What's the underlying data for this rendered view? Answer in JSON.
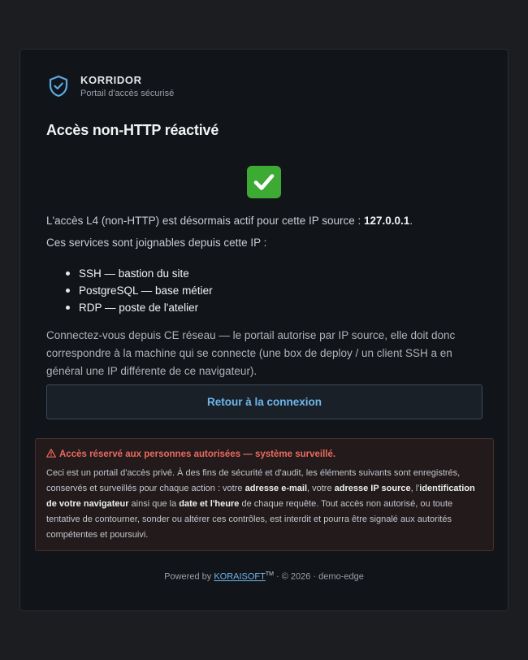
{
  "brand": {
    "name": "KORRIDOR",
    "subtitle": "Portail d'accès sécurisé",
    "icon": "shield-check-icon",
    "accent": "#5aa9e6"
  },
  "page": {
    "title": "Accès non-HTTP réactivé",
    "status_icon": "check-mark-button-icon",
    "intro_prefix": "L'accès L4 (non-HTTP) est désormais actif pour cette IP source : ",
    "source_ip": "127.0.0.1",
    "intro_suffix": ".",
    "services_intro": "Ces services sont joignables depuis cette IP :",
    "services": [
      "SSH — bastion du site",
      "PostgreSQL — base métier",
      "RDP — poste de l'atelier"
    ],
    "note": "Connectez-vous depuis CE réseau — le portail autorise par IP source, elle doit donc correspondre à la machine qui se connecte (une box de deploy / un client SSH a en général une IP différente de ce navigateur).",
    "back_button": "Retour à la connexion"
  },
  "warning": {
    "icon": "warning-triangle-icon",
    "title": "Accès réservé aux personnes autorisées — système surveillé.",
    "body": [
      {
        "t": "Ceci est un portail d'accès privé. À des fins de sécurité et d'audit, les éléments suivants sont enregistrés, conservés et surveillés pour chaque action : votre ",
        "b": false
      },
      {
        "t": "adresse e-mail",
        "b": true
      },
      {
        "t": ", votre ",
        "b": false
      },
      {
        "t": "adresse IP source",
        "b": true
      },
      {
        "t": ", l'",
        "b": false
      },
      {
        "t": "identification de votre navigateur",
        "b": true
      },
      {
        "t": " ainsi que la ",
        "b": false
      },
      {
        "t": "date et l'heure",
        "b": true
      },
      {
        "t": " de chaque requête. Tout accès non autorisé, ou toute tentative de contourner, sonder ou altérer ces contrôles, est interdit et pourra être signalé aux autorités compétentes et poursuivi.",
        "b": false
      }
    ],
    "color": "#ec6a5e"
  },
  "footer": {
    "prefix": "Powered by ",
    "link": "KORAISOFT",
    "tm": "TM",
    "suffix": " · © 2026 · demo-edge"
  }
}
